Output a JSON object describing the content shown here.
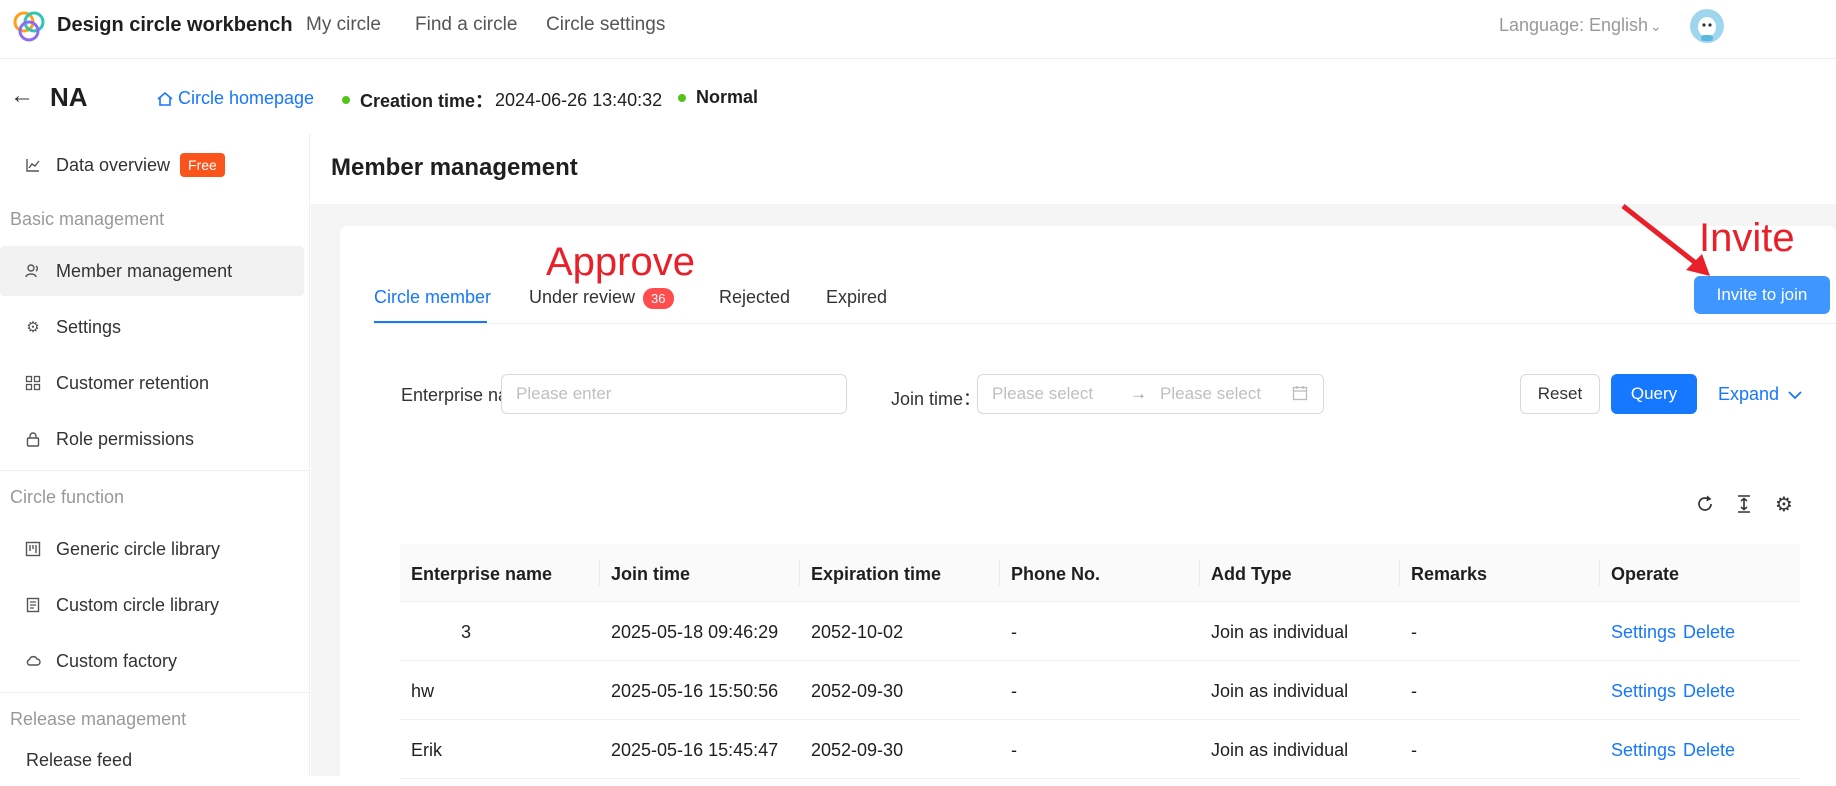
{
  "header": {
    "app_title": "Design circle workbench",
    "nav": [
      "My circle",
      "Find a circle",
      "Circle settings"
    ],
    "language_label": "Language:",
    "language_value": "English"
  },
  "subheader": {
    "circle_name": "NA",
    "homepage_link": "Circle homepage",
    "creation_label": "Creation time：",
    "creation_value": "2024-06-26 13:40:32",
    "status": "Normal",
    "status_color": "#52c41a"
  },
  "sidebar": {
    "data_overview": "Data overview",
    "free_badge": "Free",
    "groups": [
      "Basic management",
      "Circle function",
      "Release management"
    ],
    "basic_items": [
      "Member management",
      "Settings",
      "Customer retention",
      "Role permissions"
    ],
    "function_items": [
      "Generic circle library",
      "Custom circle library",
      "Custom factory"
    ],
    "release_items": [
      "Release feed"
    ]
  },
  "page": {
    "title": "Member management"
  },
  "tabs": [
    {
      "label": "Circle member",
      "active": true
    },
    {
      "label": "Under review",
      "badge": "36"
    },
    {
      "label": "Rejected"
    },
    {
      "label": "Expired"
    }
  ],
  "annotations": {
    "approve": "Approve",
    "invite": "Invite"
  },
  "invite_button": "Invite to join",
  "filters": {
    "enterprise_label": "Enterprise na",
    "enterprise_placeholder": "Please enter",
    "join_label": "Join time：",
    "start_placeholder": "Please select",
    "end_placeholder": "Please select",
    "reset": "Reset",
    "query": "Query",
    "expand": "Expand"
  },
  "table": {
    "columns": [
      "Enterprise name",
      "Join time",
      "Expiration time",
      "Phone No.",
      "Add Type",
      "Remarks",
      "Operate"
    ],
    "rows": [
      [
        "3",
        "2025-05-18 09:46:29",
        "2052-10-02",
        "-",
        "Join as individual",
        "-"
      ],
      [
        "hw",
        "2025-05-16 15:50:56",
        "2052-09-30",
        "-",
        "Join as individual",
        "-"
      ],
      [
        "Erik",
        "2025-05-16 15:45:47",
        "2052-09-30",
        "-",
        "Join as individual",
        "-"
      ]
    ],
    "op_settings": "Settings",
    "op_delete": "Delete"
  },
  "colors": {
    "accent": "#1677ff",
    "danger": "#ff4d4f",
    "annotation_red": "#e8202a",
    "free_badge": "#fa541c"
  }
}
